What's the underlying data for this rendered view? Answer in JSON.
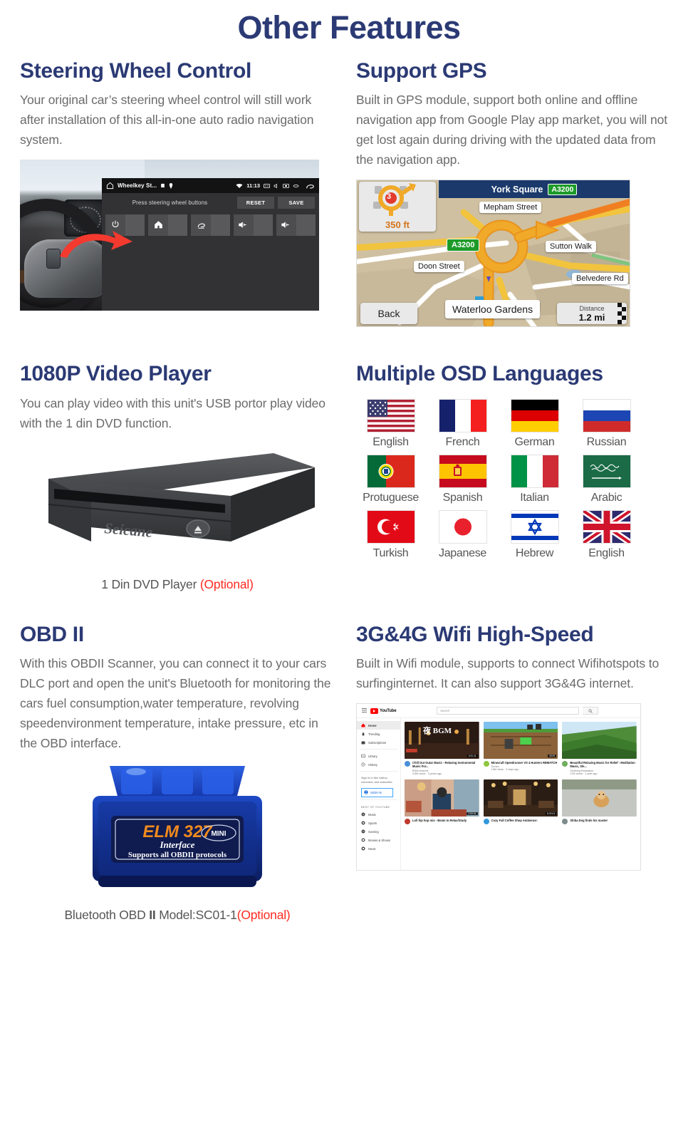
{
  "page": {
    "title": "Other Features",
    "accent_navy": "#2b3a74",
    "body_gray": "#6b6b6b",
    "optional_red": "#ff2b22"
  },
  "sections": [
    {
      "id": "steering-wheel-control",
      "title": "Steering Wheel Control",
      "body": "Your original car’s steering wheel control will still work after installation of this all-in-one auto radio navigation system."
    },
    {
      "id": "support-gps",
      "title": "Support GPS",
      "body": "Built in GPS module, support both online and offline navigation app from Google Play app market, you will not get lost again during driving with the updated data from the navigation app."
    },
    {
      "id": "video-player",
      "title": "1080P Video Player",
      "body": "You can play video with this unit's  USB portor play video with the 1 din DVD function."
    },
    {
      "id": "osd-languages",
      "title": "Multiple OSD Languages",
      "body": ""
    },
    {
      "id": "obd-ii",
      "title": "OBD II",
      "body": "With this OBDII Scanner, you can connect it to your cars DLC port and open the unit's Bluetooth for monitoring the cars fuel consumption,water temperature, revolving speedenvironment temperature, intake pressure, etc in the OBD interface."
    },
    {
      "id": "wifi",
      "title": "3G&4G Wifi High-Speed",
      "body": "Built in Wifi module, supports to connect  Wifihotspots to surfinginternet. It can also support 3G&4G internet."
    }
  ],
  "swc_screen": {
    "app_title": "Wheelkey St...",
    "clock": "11:13",
    "instruction": "Press steering wheel buttons",
    "reset_label": "RESET",
    "save_label": "SAVE",
    "slots": [
      {
        "icon": "power-icon",
        "glyph": "⏻"
      },
      {
        "icon": "home-icon",
        "glyph": "⌂"
      },
      {
        "icon": "back-icon",
        "glyph": "↩"
      },
      {
        "icon": "volume-up-icon",
        "glyph": "◂+"
      },
      {
        "icon": "volume-up-icon",
        "glyph": "◂+"
      }
    ]
  },
  "gps_screen": {
    "header_street": "York Square",
    "header_shield": "A3200",
    "turn_distance": "350 ft",
    "roundabout_exit": "3",
    "labels": [
      "Mepham Street",
      "A3200",
      "Sutton Walk",
      "Doon Street",
      "Belvedere Rd",
      "Waterloo Gardens"
    ],
    "back_label": "Back",
    "distance_label": "Distance",
    "distance_value": "1.2 mi"
  },
  "dvd": {
    "brand": "Seicane",
    "eject_icon": "eject-icon",
    "caption_main": "1 Din DVD Player ",
    "caption_optional": "(Optional)"
  },
  "languages": [
    {
      "name": "English",
      "flag": "us"
    },
    {
      "name": "French",
      "flag": "fr"
    },
    {
      "name": "German",
      "flag": "de"
    },
    {
      "name": "Russian",
      "flag": "ru"
    },
    {
      "name": "Protuguese",
      "flag": "pt"
    },
    {
      "name": "Spanish",
      "flag": "es"
    },
    {
      "name": "Italian",
      "flag": "it"
    },
    {
      "name": "Arabic",
      "flag": "sa"
    },
    {
      "name": "Turkish",
      "flag": "tr"
    },
    {
      "name": "Japanese",
      "flag": "jp"
    },
    {
      "name": "Hebrew",
      "flag": "il"
    },
    {
      "name": "English",
      "flag": "gb"
    }
  ],
  "elm": {
    "brand": "ELM 327",
    "mini": "MINI",
    "interface": "Interface",
    "protocols": "Supports all OBDII protocols",
    "caption_pre": "Bluetooth OBD ",
    "caption_ii": "II",
    "caption_mid": " Model:SC01-1",
    "caption_optional": "(Optional)"
  },
  "youtube": {
    "wordmark": "YouTube",
    "search_placeholder": "Search",
    "sidebar": [
      {
        "label": "Home",
        "icon": "home-icon",
        "active": true
      },
      {
        "label": "Trending",
        "icon": "trending-icon",
        "active": false
      },
      {
        "label": "Subscriptions",
        "icon": "subscriptions-icon",
        "active": false
      },
      {
        "label": "Library",
        "icon": "library-icon",
        "active": false
      },
      {
        "label": "History",
        "icon": "history-icon",
        "active": false
      }
    ],
    "signin_prompt": "Sign in to like videos, comment, and subscribe.",
    "signin_button": "SIGN IN",
    "best_of_header": "BEST OF YOUTUBE",
    "categories": [
      {
        "label": "Music",
        "icon": "music-icon"
      },
      {
        "label": "Sports",
        "icon": "sports-icon"
      },
      {
        "label": "Gaming",
        "icon": "gaming-icon"
      },
      {
        "label": "Movies & Shows",
        "icon": "movies-icon"
      },
      {
        "label": "News",
        "icon": "news-icon"
      }
    ],
    "videos": [
      {
        "title": "Chill Out Gutar Music - Relaxing Instrumental Music For...",
        "channel": "BGM channel",
        "views": "4.8M views · 3 years ago",
        "duration": "3:31:11",
        "thumb_text": "夜 BGM"
      },
      {
        "title": "Minecraft Speedrunner VS 4 Hunters REMATCH",
        "channel": "Dream",
        "views": "16M views · 5 days ago",
        "duration": "45:09",
        "thumb_text": ""
      },
      {
        "title": "Beautiful Relaxing Music for Relief - Meditation Music, Sle...",
        "channel": "Soothing Relaxation",
        "views": "17M views · 1 year ago",
        "duration": "",
        "thumb_text": ""
      },
      {
        "title": "Lofi hip hop mix - Beats to Relax/Study",
        "channel": "",
        "views": "",
        "duration": "2:00:01",
        "thumb_text": ""
      },
      {
        "title": "Cozy Fall Coffee Shop Ambience:",
        "channel": "",
        "views": "",
        "duration": "8:02:01",
        "thumb_text": ""
      },
      {
        "title": "Shiba Dog finds his master",
        "channel": "",
        "views": "",
        "duration": "",
        "thumb_text": ""
      }
    ]
  }
}
